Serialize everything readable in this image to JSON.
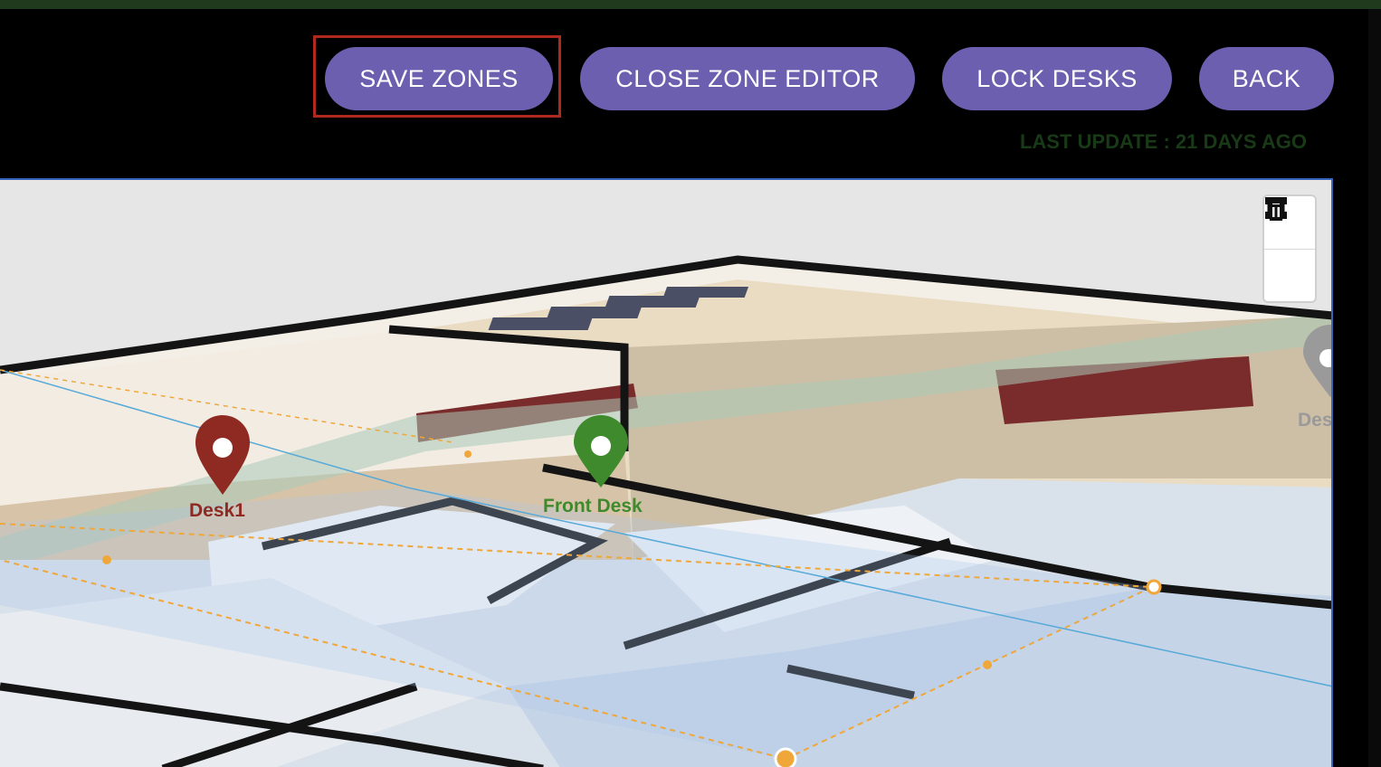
{
  "toolbar": {
    "save_zones": "SAVE ZONES",
    "close_zone_editor": "CLOSE ZONE EDITOR",
    "lock_desks": "LOCK DESKS",
    "back": "BACK"
  },
  "status": {
    "last_update": "LAST UPDATE : 21 DAYS AGO"
  },
  "map": {
    "markers": [
      {
        "label": "Desk1",
        "color": "#8e2a22"
      },
      {
        "label": "Front Desk",
        "color": "#3f8a2c"
      },
      {
        "label": "Des",
        "color": "#9a9a9a"
      }
    ],
    "controls": {
      "draw": "vector-square-icon",
      "delete": "trash-icon"
    }
  },
  "colors": {
    "button": "#6d5fb0",
    "highlight": "#b0291e",
    "zone_line": "#f0a73a",
    "zone_fill": "#a9c6ee"
  }
}
